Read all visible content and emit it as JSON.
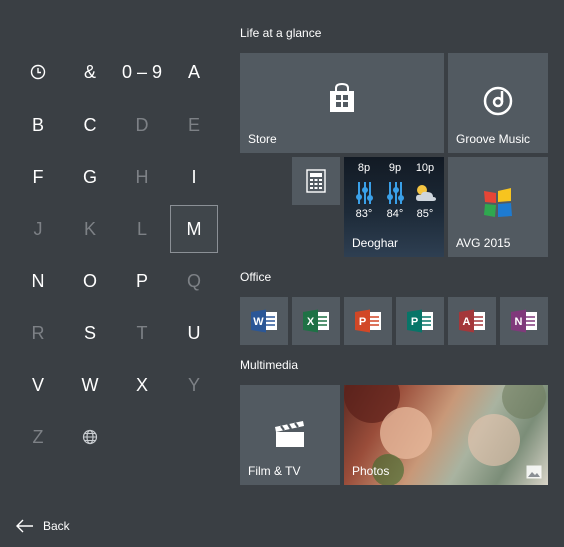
{
  "jump_list": {
    "rows": [
      [
        {
          "label": "",
          "icon": "clock-icon",
          "dim": false
        },
        {
          "label": "&",
          "dim": false
        },
        {
          "label": "0 – 9",
          "dim": false
        },
        {
          "label": "A",
          "dim": false
        }
      ],
      [
        {
          "label": "B",
          "dim": false
        },
        {
          "label": "C",
          "dim": false
        },
        {
          "label": "D",
          "dim": true
        },
        {
          "label": "E",
          "dim": true
        }
      ],
      [
        {
          "label": "F",
          "dim": false
        },
        {
          "label": "G",
          "dim": false
        },
        {
          "label": "H",
          "dim": true
        },
        {
          "label": "I",
          "dim": false
        }
      ],
      [
        {
          "label": "J",
          "dim": true
        },
        {
          "label": "K",
          "dim": true
        },
        {
          "label": "L",
          "dim": true
        },
        {
          "label": "M",
          "dim": false,
          "selected": true
        }
      ],
      [
        {
          "label": "N",
          "dim": false
        },
        {
          "label": "O",
          "dim": false
        },
        {
          "label": "P",
          "dim": false
        },
        {
          "label": "Q",
          "dim": true
        }
      ],
      [
        {
          "label": "R",
          "dim": true
        },
        {
          "label": "S",
          "dim": false
        },
        {
          "label": "T",
          "dim": true
        },
        {
          "label": "U",
          "dim": false
        }
      ],
      [
        {
          "label": "V",
          "dim": false
        },
        {
          "label": "W",
          "dim": false
        },
        {
          "label": "X",
          "dim": false
        },
        {
          "label": "Y",
          "dim": true
        }
      ],
      [
        {
          "label": "Z",
          "dim": true
        },
        {
          "label": "",
          "icon": "globe-icon",
          "dim": false
        }
      ]
    ]
  },
  "back_label": "Back",
  "groups": {
    "life": "Life at a glance",
    "office": "Office",
    "multimedia": "Multimedia"
  },
  "tiles": {
    "store": "Store",
    "groove": "Groove Music",
    "calculator_icon": "calculator-icon",
    "weather": {
      "location": "Deoghar",
      "forecast": [
        {
          "hour": "8p",
          "temp": "83°"
        },
        {
          "hour": "9p",
          "temp": "84°"
        },
        {
          "hour": "10p",
          "temp": "85°"
        }
      ]
    },
    "avg": "AVG 2015",
    "office_apps": [
      {
        "name": "word-icon",
        "letter": "W",
        "color": "#2b5797"
      },
      {
        "name": "excel-icon",
        "letter": "X",
        "color": "#1e7145"
      },
      {
        "name": "powerpoint-icon",
        "letter": "P",
        "color": "#d24726"
      },
      {
        "name": "publisher-icon",
        "letter": "P",
        "color": "#077568"
      },
      {
        "name": "access-icon",
        "letter": "A",
        "color": "#a4373a"
      },
      {
        "name": "onenote-icon",
        "letter": "N",
        "color": "#80397b"
      }
    ],
    "film": "Film & TV",
    "photos": "Photos"
  },
  "colors": {
    "background": "#3a3f44",
    "tile": "#525a61",
    "weather_accent": "#3aa0e8",
    "dim_letter": "#7d8186"
  }
}
